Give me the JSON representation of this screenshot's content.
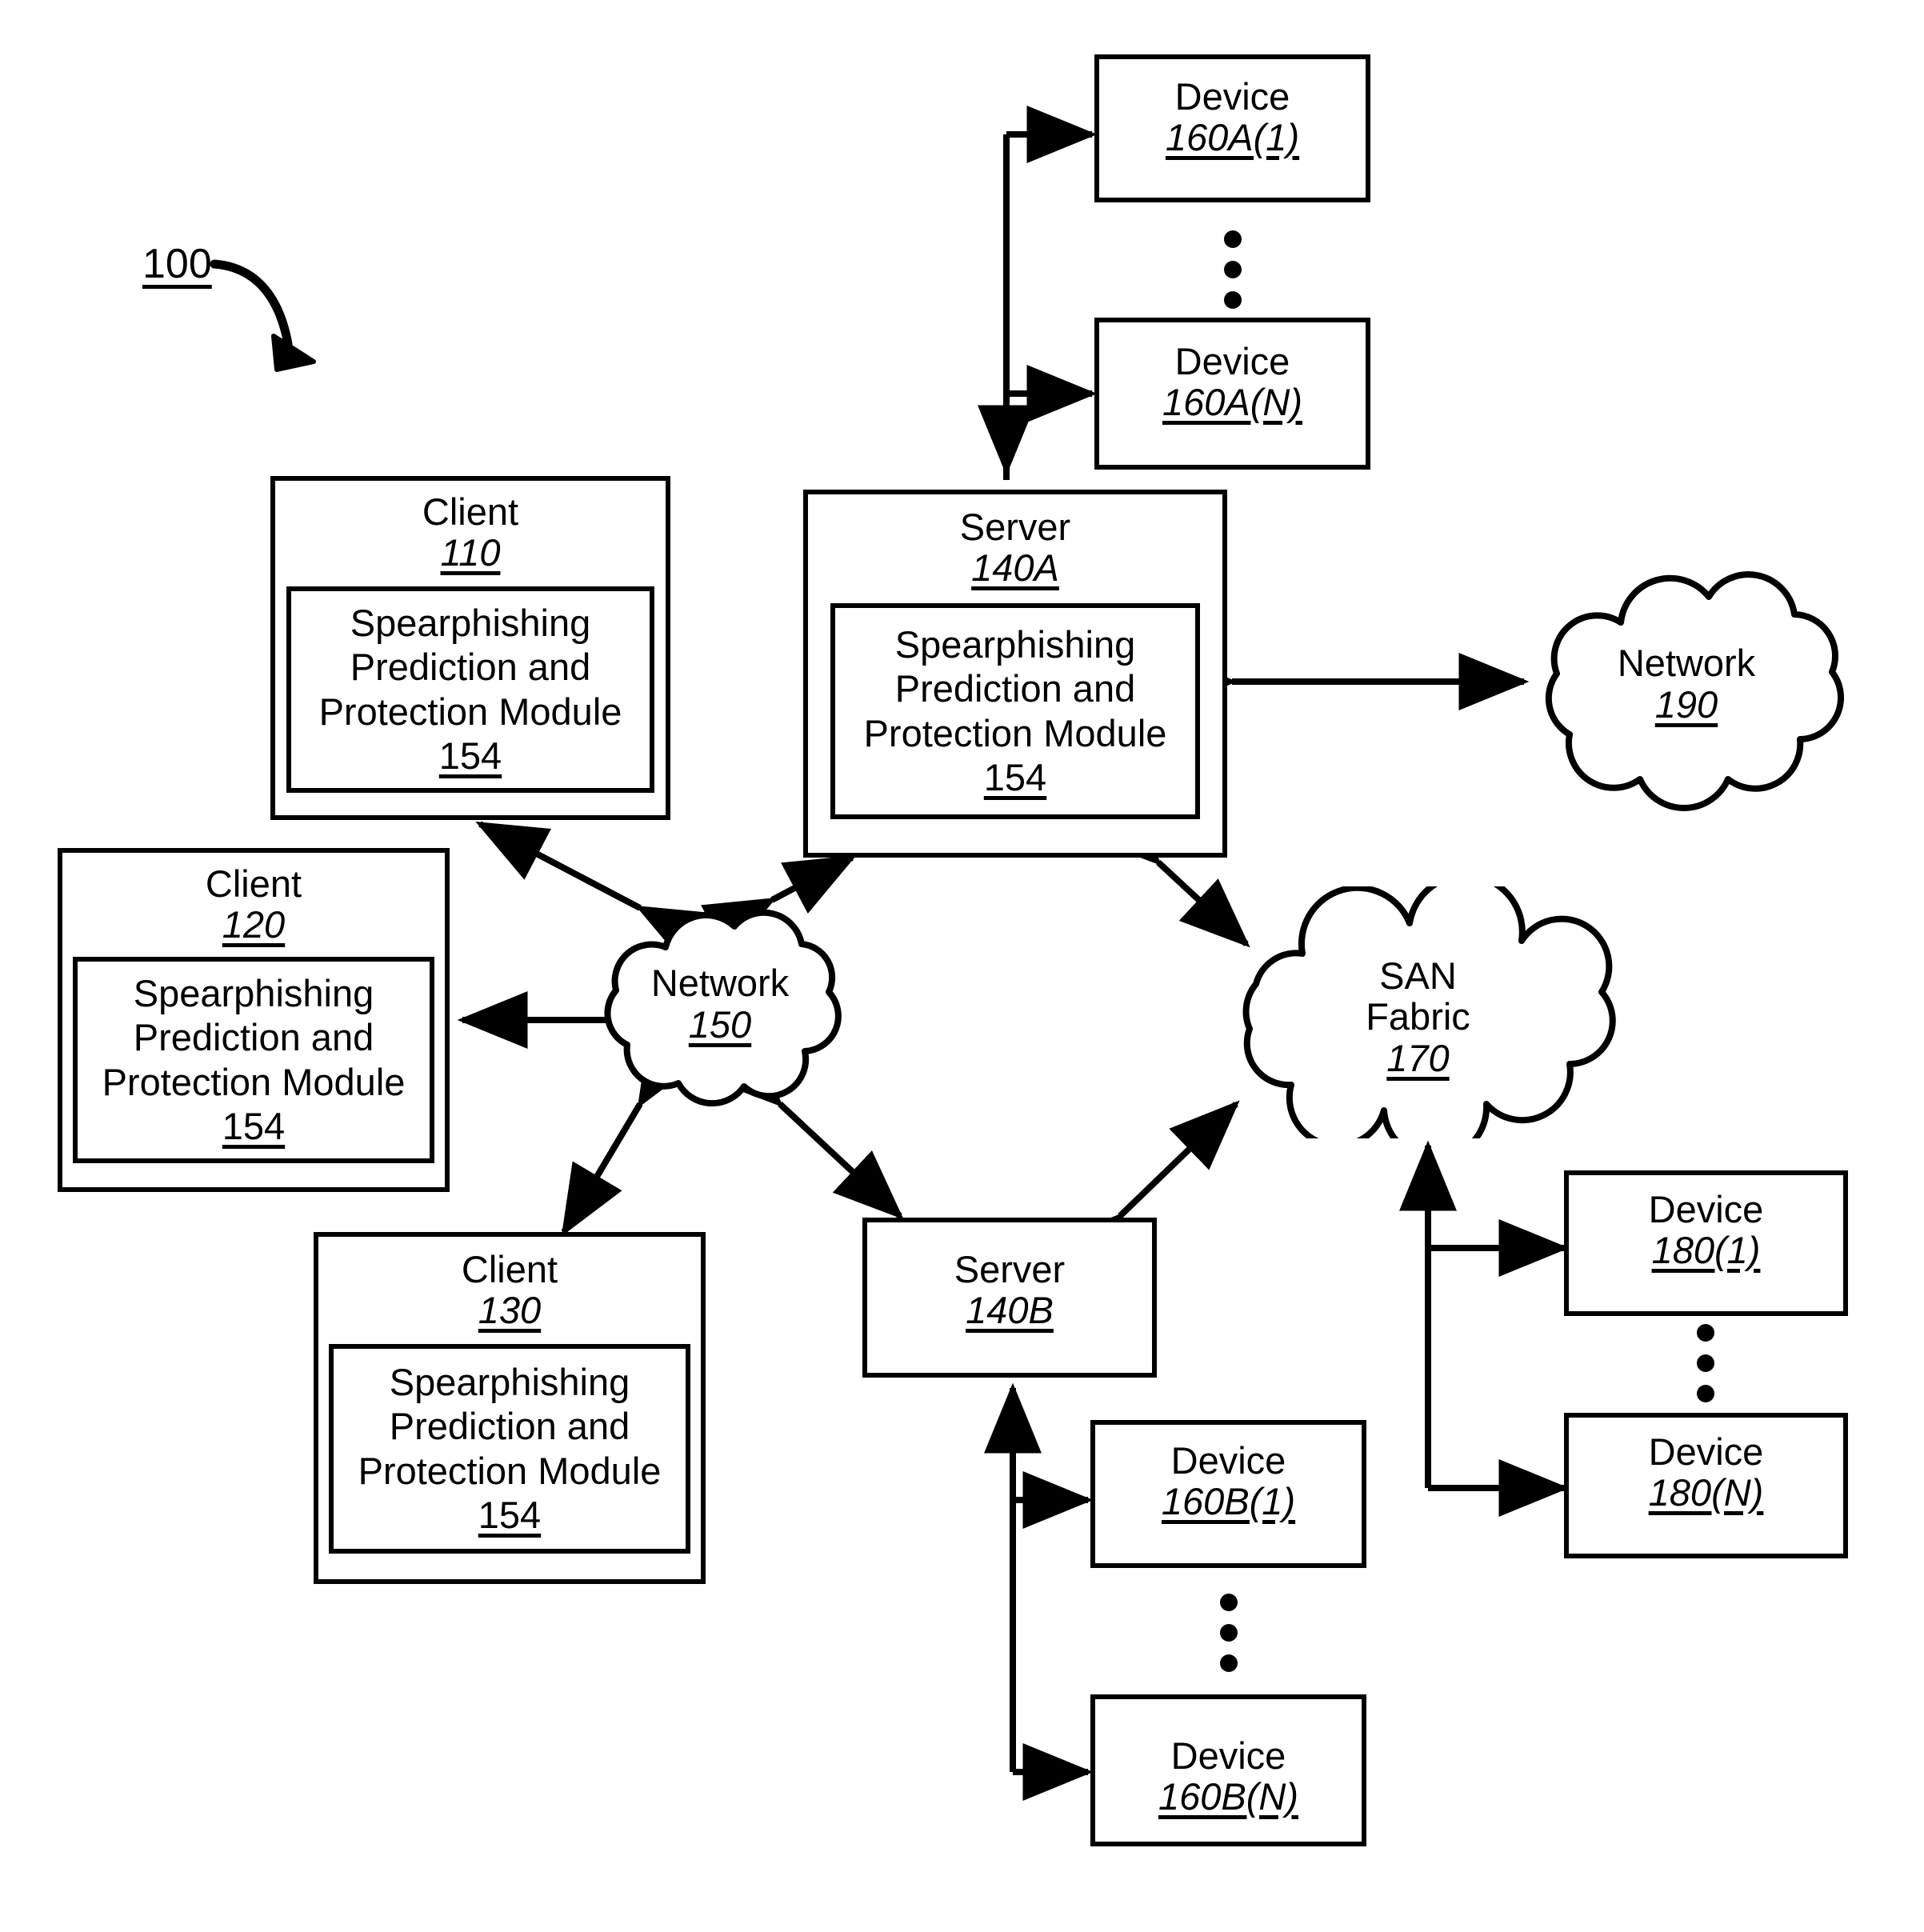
{
  "figure": {
    "label": "100"
  },
  "module_text": {
    "line1": "Spearphishing",
    "line2": "Prediction and",
    "line3": "Protection Module",
    "ref": "154"
  },
  "nodes": {
    "client110": {
      "title": "Client",
      "ref": "110"
    },
    "client120": {
      "title": "Client",
      "ref": "120"
    },
    "client130": {
      "title": "Client",
      "ref": "130"
    },
    "server140a": {
      "title": "Server",
      "ref": "140A"
    },
    "server140b": {
      "title": "Server",
      "ref": "140B"
    },
    "device160a1": {
      "title": "Device",
      "ref": "160A(1)"
    },
    "device160an": {
      "title": "Device",
      "ref": "160A(N)"
    },
    "device160b1": {
      "title": "Device",
      "ref": "160B(1)"
    },
    "device160bn": {
      "title": "Device",
      "ref": "160B(N)"
    },
    "device1801": {
      "title": "Device",
      "ref": "180(1)"
    },
    "device180n": {
      "title": "Device",
      "ref": "180(N)"
    },
    "network150": {
      "title": "Network",
      "ref": "150"
    },
    "network190": {
      "title": "Network",
      "ref": "190"
    },
    "sanfabric170": {
      "title_line1": "SAN",
      "title_line2": "Fabric",
      "ref": "170"
    }
  },
  "colors": {
    "stroke": "#000000",
    "background": "#ffffff"
  }
}
